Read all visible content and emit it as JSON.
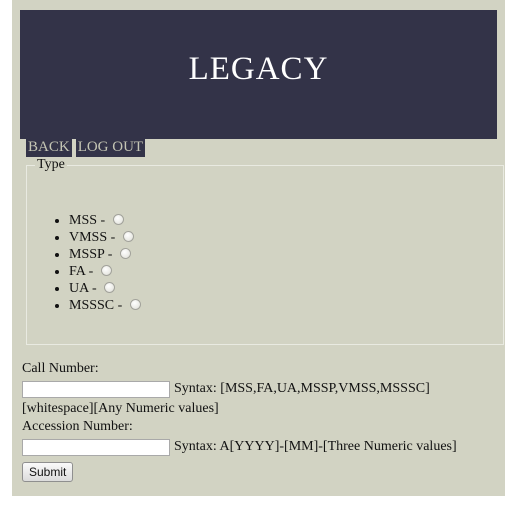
{
  "header": {
    "title": "LEGACY"
  },
  "nav": {
    "back_label": "BACK",
    "logout_label": "LOG OUT"
  },
  "type_group": {
    "legend": "Type",
    "options": [
      {
        "label": "MSS -"
      },
      {
        "label": "VMSS -"
      },
      {
        "label": "MSSP -"
      },
      {
        "label": "FA -"
      },
      {
        "label": "UA -"
      },
      {
        "label": "MSSSC -"
      }
    ]
  },
  "call_number": {
    "label": "Call Number:",
    "value": "",
    "syntax": "Syntax: [MSS,FA,UA,MSSP,VMSS,MSSSC]",
    "syntax_cont": "[whitespace][Any Numeric values]"
  },
  "accession_number": {
    "label": "Accession Number:",
    "value": "",
    "syntax": "Syntax: A[YYYY]-[MM]-[Three Numeric values]"
  },
  "submit_label": "Submit",
  "colors": {
    "banner": "#333348",
    "page_bg": "#d2d3c3",
    "nav_text": "#c4c5b4"
  }
}
